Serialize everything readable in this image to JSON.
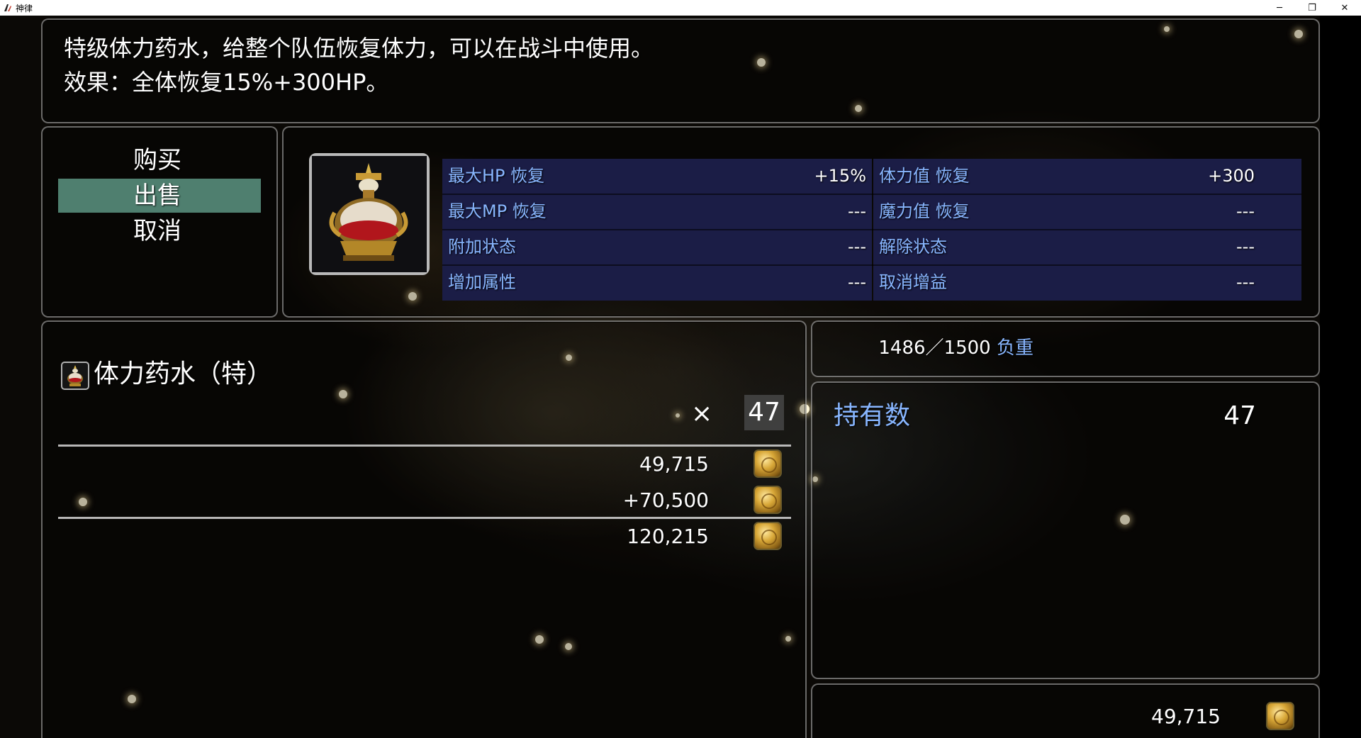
{
  "window": {
    "title": "神律",
    "minimize_glyph": "─",
    "restore_glyph": "❐",
    "close_glyph": "✕"
  },
  "help": {
    "line1": "特级体力药水，给整个队伍恢复体力，可以在战斗中使用。",
    "line2": "效果：全体恢复15%+300HP。"
  },
  "commands": [
    {
      "label": "购买",
      "selected": false
    },
    {
      "label": "出售",
      "selected": true
    },
    {
      "label": "取消",
      "selected": false
    }
  ],
  "item_icon": "potion-icon",
  "stats": {
    "left": [
      {
        "label": "最大HP 恢复",
        "value": "+15%"
      },
      {
        "label": "最大MP 恢复",
        "value": "---"
      },
      {
        "label": "附加状态",
        "value": "---"
      },
      {
        "label": "增加属性",
        "value": "---"
      }
    ],
    "right": [
      {
        "label": "体力值 恢复",
        "value": "+300"
      },
      {
        "label": "魔力值 恢复",
        "value": "---"
      },
      {
        "label": "解除状态",
        "value": "---"
      },
      {
        "label": "取消增益",
        "value": "---"
      }
    ]
  },
  "trade": {
    "item_name": "体力药水（特）",
    "times_sign": "×",
    "quantity": "47",
    "current_gold": "49,715",
    "change": "+70,500",
    "result": "120,215"
  },
  "weight": {
    "value": "1486／1500",
    "unit": "负重"
  },
  "owned": {
    "label": "持有数",
    "value": "47"
  },
  "gold": {
    "value": "49,715"
  },
  "colors": {
    "system_blue": "#88b6ff",
    "selection": "#4f7f6f",
    "stats_background": "#1b1d46"
  }
}
